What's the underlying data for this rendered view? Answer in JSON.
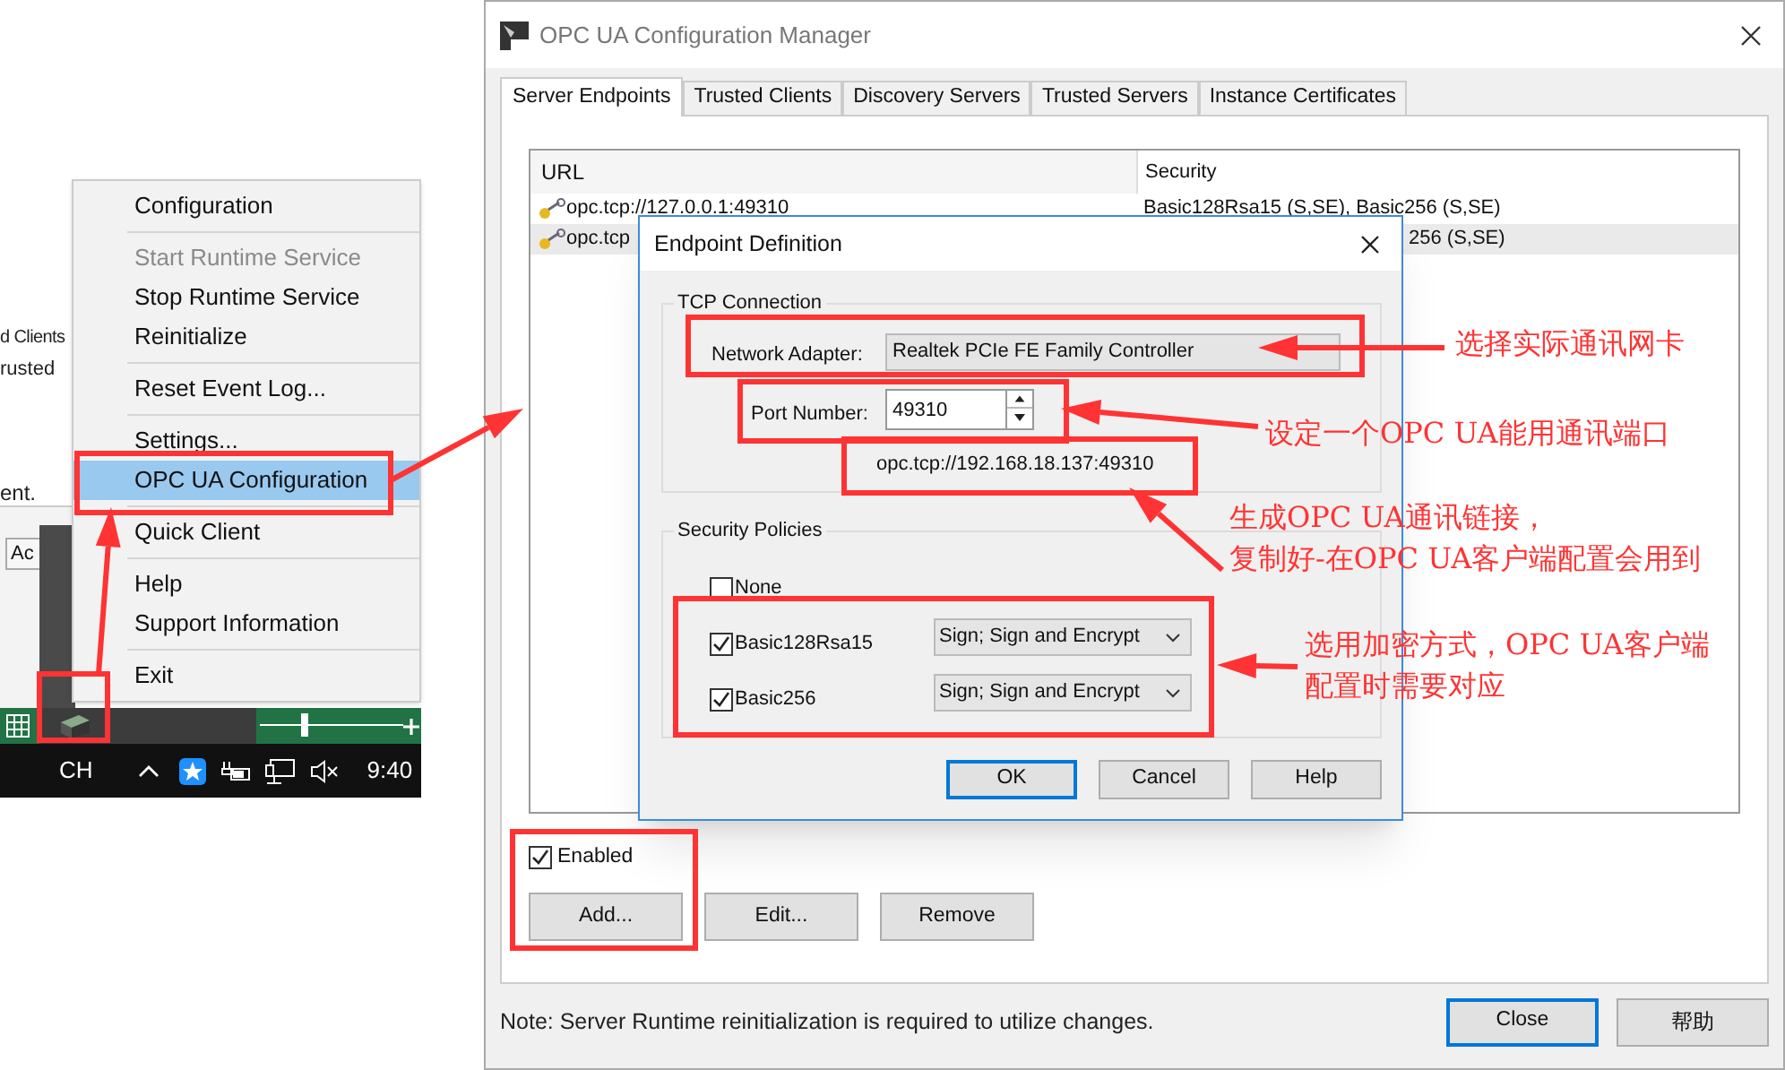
{
  "background_fragments": [
    "d Clients",
    "rusted",
    "ent.",
    "Ac"
  ],
  "zoom_slider": {
    "level": 0.3
  },
  "tray_menu": {
    "groups": [
      [
        {
          "label": "Configuration",
          "disabled": false,
          "selected": false
        }
      ],
      [
        {
          "label": "Start Runtime Service",
          "disabled": true,
          "selected": false
        },
        {
          "label": "Stop Runtime Service",
          "disabled": false,
          "selected": false
        },
        {
          "label": "Reinitialize",
          "disabled": false,
          "selected": false
        }
      ],
      [
        {
          "label": "Reset Event Log...",
          "disabled": false,
          "selected": false
        }
      ],
      [
        {
          "label": "Settings...",
          "disabled": false,
          "selected": false
        },
        {
          "label": "OPC UA Configuration",
          "disabled": false,
          "selected": true
        }
      ],
      [
        {
          "label": "Quick Client",
          "disabled": false,
          "selected": false
        }
      ],
      [
        {
          "label": "Help",
          "disabled": false,
          "selected": false
        },
        {
          "label": "Support Information",
          "disabled": false,
          "selected": false
        }
      ],
      [
        {
          "label": "Exit",
          "disabled": false,
          "selected": false
        }
      ]
    ]
  },
  "taskbar": {
    "language": "CH",
    "clock": "9:40"
  },
  "main_window": {
    "title": "OPC UA Configuration Manager",
    "tabs": [
      {
        "label": "Server Endpoints",
        "selected": true
      },
      {
        "label": "Trusted Clients",
        "selected": false
      },
      {
        "label": "Discovery Servers",
        "selected": false
      },
      {
        "label": "Trusted Servers",
        "selected": false
      },
      {
        "label": "Instance Certificates",
        "selected": false
      }
    ],
    "columns": [
      "URL",
      "Security"
    ],
    "rows": [
      {
        "url": "opc.tcp://127.0.0.1:49310",
        "security": "Basic128Rsa15 (S,SE), Basic256 (S,SE)",
        "selected": false
      },
      {
        "url": "opc.tcp",
        "security": "256 (S,SE)",
        "selected": true
      }
    ],
    "enabled": {
      "label": "Enabled",
      "checked": true
    },
    "buttons": [
      "Add...",
      "Edit...",
      "Remove"
    ],
    "note": "Note: Server Runtime reinitialization is required to utilize changes.",
    "footer_buttons": [
      "Close",
      "帮助"
    ]
  },
  "dialog": {
    "title": "Endpoint Definition",
    "tcp_group": "TCP Connection",
    "adapter": {
      "label": "Network Adapter:",
      "value": "Realtek PCIe FE Family Controller"
    },
    "port": {
      "label": "Port Number:",
      "value": "49310"
    },
    "endpoint_url": "opc.tcp://192.168.18.137:49310",
    "security_group": "Security Policies",
    "none": {
      "label": "None",
      "checked": false
    },
    "policies": [
      {
        "name": "Basic128Rsa15",
        "checked": true,
        "mode": "Sign; Sign and Encrypt"
      },
      {
        "name": "Basic256",
        "checked": true,
        "mode": "Sign; Sign and Encrypt"
      }
    ],
    "buttons": [
      "OK",
      "Cancel",
      "Help"
    ]
  },
  "annotations": [
    {
      "lines": [
        "选择实际通讯网卡"
      ]
    },
    {
      "lines": [
        "设定一个OPC UA能用通讯端口"
      ]
    },
    {
      "lines": [
        "生成OPC UA通讯链接，",
        "复制好-在OPC UA客户端配置会用到"
      ]
    },
    {
      "lines": [
        "选用加密方式，OPC UA客户端",
        "配置时需要对应"
      ]
    }
  ]
}
